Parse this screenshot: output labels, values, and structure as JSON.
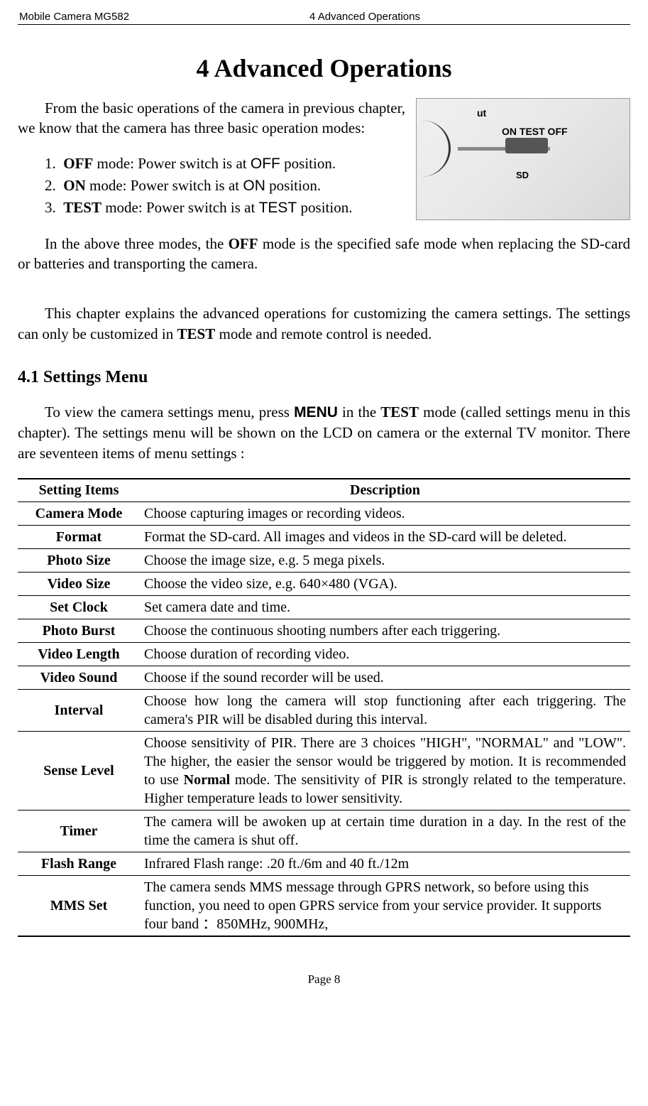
{
  "header": {
    "left": "Mobile Camera MG582",
    "center": "4 Advanced Operations"
  },
  "chapter_title": "4   Advanced Operations",
  "intro": "From the basic operations of the camera in previous chapter, we know that the camera has three basic operation modes:",
  "modes": [
    {
      "n": "1.",
      "bold": "OFF",
      "rest1": " mode: Power switch is at ",
      "mono": "OFF",
      "rest2": " position."
    },
    {
      "n": "2.",
      "bold": "ON",
      "rest1": " mode: Power switch is at ",
      "mono": "ON",
      "rest2": " position."
    },
    {
      "n": "3.",
      "bold": "TEST",
      "rest1": " mode: Power switch is at ",
      "mono": "TEST",
      "rest2": " position."
    }
  ],
  "after_list_1a": "In the above three modes, the ",
  "after_list_1b": "OFF",
  "after_list_1c": " mode is the specified safe mode when replacing the SD-card or batteries and transporting the camera.",
  "after_list_2a": "This chapter explains the advanced operations for customizing the camera settings. The settings can only be customized in ",
  "after_list_2b": "TEST",
  "after_list_2c": " mode and remote control is needed.",
  "section_title": "4.1  Settings Menu",
  "section_body_a": "To view the camera settings menu, press ",
  "section_body_menu": "MENU",
  "section_body_b": " in the ",
  "section_body_test": "TEST",
  "section_body_c": " mode (called settings menu in this chapter). The settings menu will be shown on the LCD on camera or the external TV monitor. There are seventeen items of menu settings :",
  "image_labels": {
    "nut": "ut",
    "ontestoff": "ON  TEST  OFF",
    "sd": "SD"
  },
  "table": {
    "head": [
      "Setting Items",
      "Description"
    ],
    "rows": [
      {
        "name": "Camera Mode",
        "desc": "Choose capturing images or recording videos."
      },
      {
        "name": "Format",
        "desc": "Format the SD-card. All images and videos in the SD-card will be deleted."
      },
      {
        "name": "Photo Size",
        "desc": "Choose the image size, e.g. 5 mega pixels."
      },
      {
        "name": "Video Size",
        "desc": "Choose the video size, e.g. 640×480 (VGA)."
      },
      {
        "name": "Set Clock",
        "desc": "Set camera date and time."
      },
      {
        "name": "Photo Burst",
        "desc": "Choose the continuous shooting numbers after each triggering."
      },
      {
        "name": "Video Length",
        "desc": "Choose duration of recording video."
      },
      {
        "name": "Video Sound",
        "desc": "Choose if the sound recorder will be used."
      },
      {
        "name": "Interval",
        "desc": "Choose how long the camera will stop functioning after each triggering. The camera's PIR will be disabled during this interval."
      },
      {
        "name": "Sense Level",
        "desc_a": "Choose sensitivity of PIR. There are 3 choices \"HIGH\", \"NORMAL\" and \"LOW\". The higher, the easier the sensor would be triggered by motion. It is recommended to use ",
        "desc_bold": "Normal",
        "desc_b": " mode. The sensitivity of PIR is strongly related to the temperature. Higher temperature leads to lower sensitivity."
      },
      {
        "name": "Timer",
        "desc": "The camera will be awoken up at certain time duration in a day. In the rest of the time the camera is shut off."
      },
      {
        "name": "Flash Range",
        "desc": "Infrared Flash range: .20 ft./6m and 40 ft./12m"
      },
      {
        "name": "MMS Set",
        "desc": "The camera sends MMS message through GPRS network, so before using this function, you need to open GPRS service from your service provider. It supports four band ：850MHz, 900MHz,"
      }
    ]
  },
  "footer": "Page 8"
}
